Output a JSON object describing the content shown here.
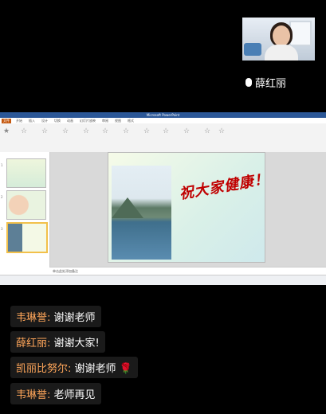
{
  "speaker": {
    "name": "薛红丽"
  },
  "ppt": {
    "window_title": "Microsoft PowerPoint",
    "tabs": [
      "文件",
      "开始",
      "插入",
      "设计",
      "切换",
      "动画",
      "幻灯片放映",
      "审阅",
      "视图",
      "格式"
    ],
    "notes_placeholder": "单击此处添加备注",
    "slide_text": "祝大家健康！"
  },
  "chat": [
    {
      "name": "韦琳誉",
      "message": "谢谢老师"
    },
    {
      "name": "薛红丽",
      "message": "谢谢大家!"
    },
    {
      "name": "凯丽比努尔",
      "message": "谢谢老师 🌹"
    },
    {
      "name": "韦琳誉",
      "message": "老师再见"
    }
  ]
}
